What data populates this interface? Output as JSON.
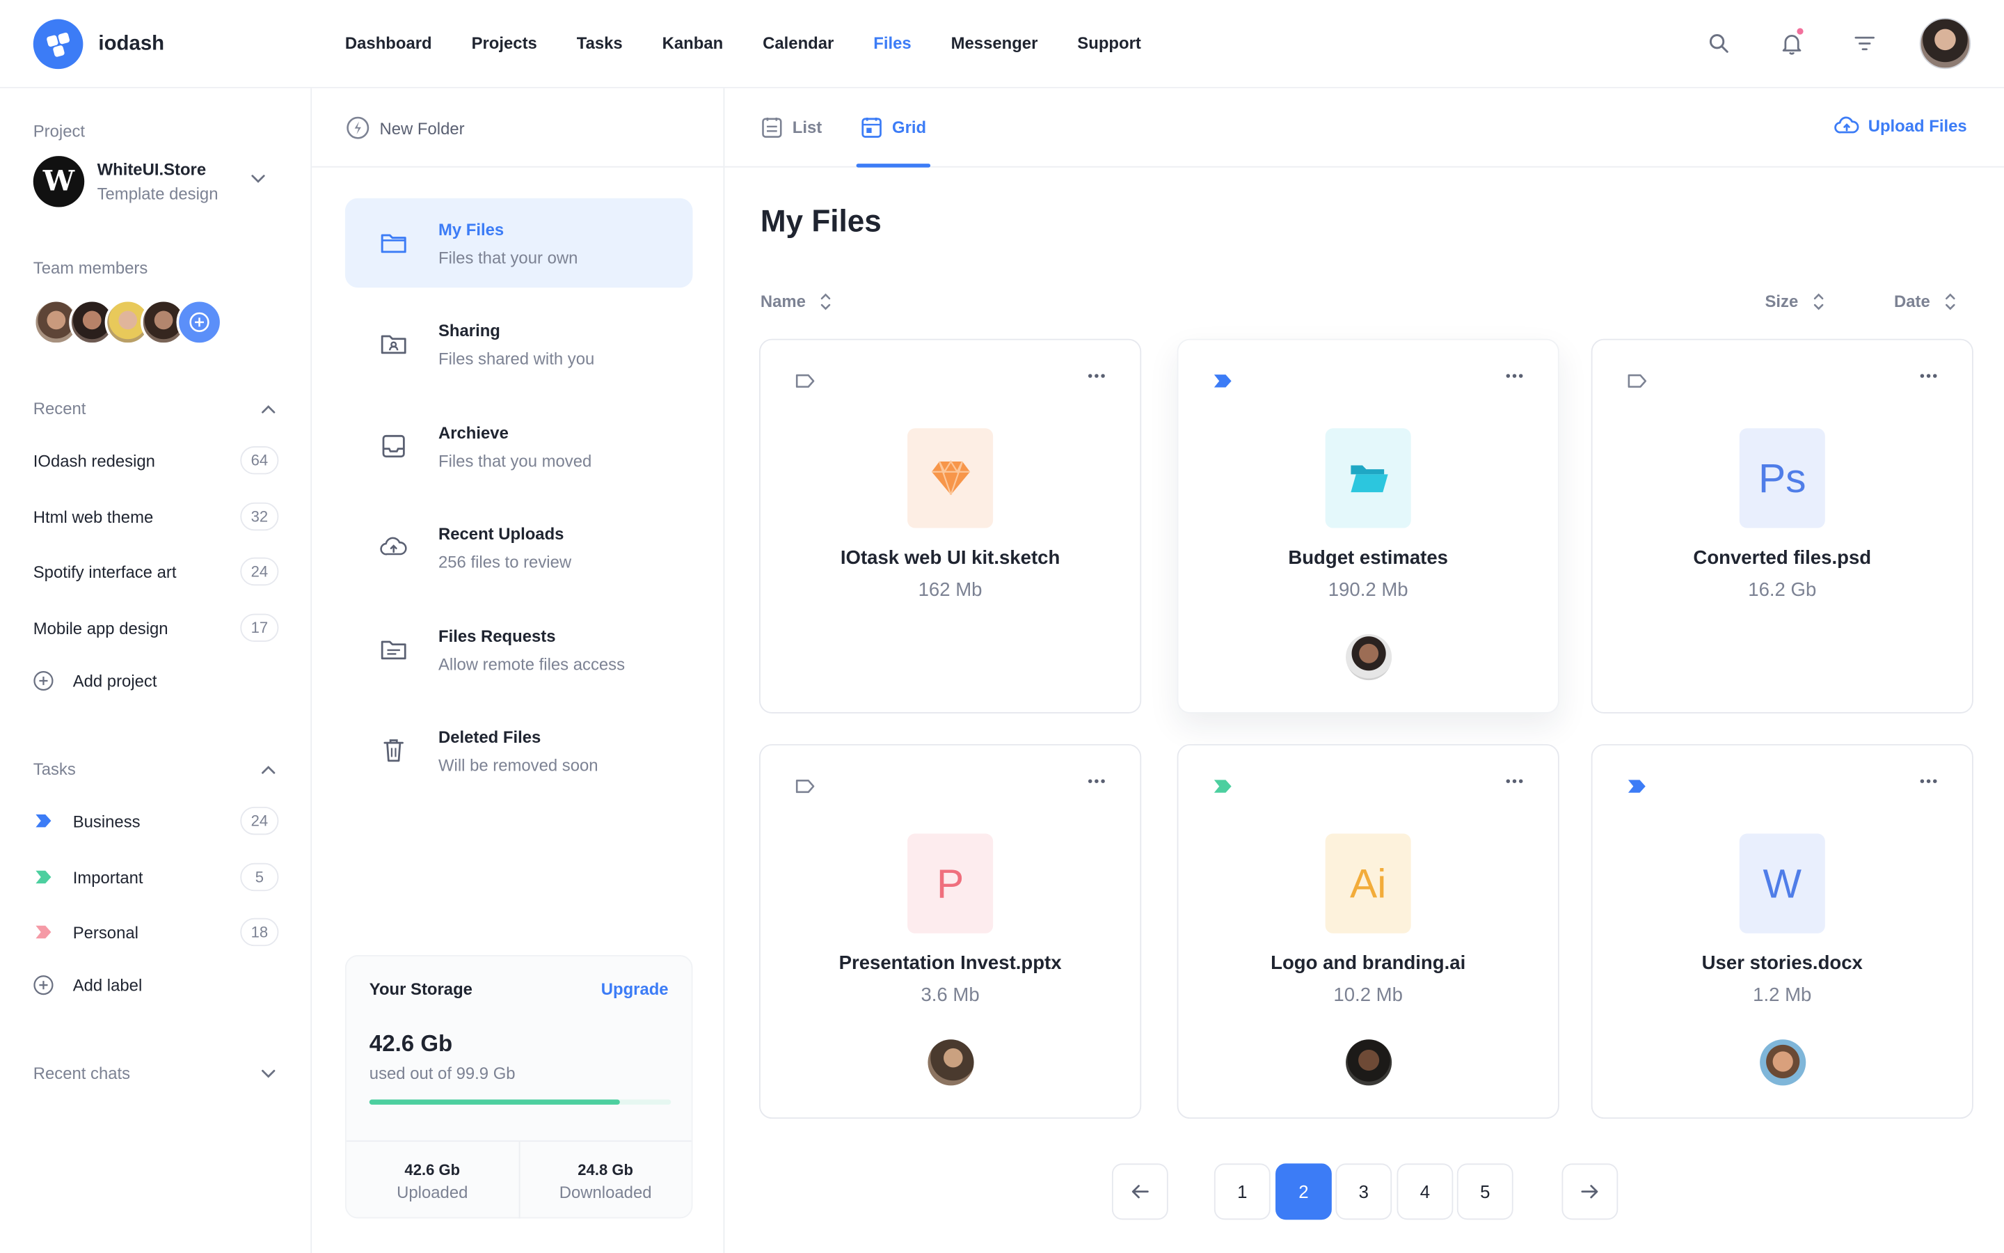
{
  "app": {
    "name": "iodash"
  },
  "nav": [
    "Dashboard",
    "Projects",
    "Tasks",
    "Kanban",
    "Calendar",
    "Files",
    "Messenger",
    "Support"
  ],
  "nav_active": "Files",
  "sidebar": {
    "project_label": "Project",
    "project_name": "WhiteUI.Store",
    "project_sub": "Template design",
    "project_logo_letter": "W",
    "team_label": "Team members",
    "recent_label": "Recent",
    "recent": [
      {
        "label": "IOdash redesign",
        "count": "64"
      },
      {
        "label": "Html web theme",
        "count": "32"
      },
      {
        "label": "Spotify interface art",
        "count": "24"
      },
      {
        "label": "Mobile app design",
        "count": "17"
      }
    ],
    "add_project": "Add project",
    "tasks_label": "Tasks",
    "tasks": [
      {
        "label": "Business",
        "count": "24",
        "color": "#3c7cf6"
      },
      {
        "label": "Important",
        "count": "5",
        "color": "#4ccf9f"
      },
      {
        "label": "Personal",
        "count": "18",
        "color": "#f59aa6"
      }
    ],
    "add_label": "Add label",
    "recent_chats": "Recent chats"
  },
  "folders": {
    "new_folder": "New Folder",
    "items": [
      {
        "title": "My Files",
        "sub": "Files that your own"
      },
      {
        "title": "Sharing",
        "sub": "Files shared with you"
      },
      {
        "title": "Archieve",
        "sub": "Files that you moved"
      },
      {
        "title": "Recent Uploads",
        "sub": "256 files to review"
      },
      {
        "title": "Files Requests",
        "sub": "Allow remote files access"
      },
      {
        "title": "Deleted Files",
        "sub": "Will be removed soon"
      }
    ]
  },
  "storage": {
    "title": "Your Storage",
    "upgrade": "Upgrade",
    "used": "42.6 Gb",
    "used_sub": "used out of 99.9 Gb",
    "used_fraction": 0.83,
    "uploaded_value": "42.6 Gb",
    "uploaded_label": "Uploaded",
    "downloaded_value": "24.8 Gb",
    "downloaded_label": "Downloaded"
  },
  "main": {
    "tab_list": "List",
    "tab_grid": "Grid",
    "upload": "Upload Files",
    "title": "My Files",
    "col_name": "Name",
    "col_size": "Size",
    "col_date": "Date"
  },
  "files": [
    {
      "name": "IOtask web UI kit.sketch",
      "size": "162 Mb",
      "icon": "sketch-diamond",
      "glyph": "",
      "bg": "#fdeee4",
      "fg": "#f7964a",
      "tag": "outline"
    },
    {
      "name": "Budget estimates",
      "size": "190.2 Mb",
      "icon": "folder-open",
      "glyph": "",
      "bg": "#e4f8fb",
      "fg": "#2cc6de",
      "tag": "blue"
    },
    {
      "name": "Converted files.psd",
      "size": "16.2 Gb",
      "icon": "photoshop",
      "glyph": "Ps",
      "bg": "#e9effd",
      "fg": "#4f7de8",
      "tag": "outline"
    },
    {
      "name": "Presentation Invest.pptx",
      "size": "3.6 Mb",
      "icon": "powerpoint",
      "glyph": "P",
      "bg": "#fdecee",
      "fg": "#ef6f7d",
      "tag": "outline"
    },
    {
      "name": "Logo and branding.ai",
      "size": "10.2 Mb",
      "icon": "illustrator",
      "glyph": "Ai",
      "bg": "#fdf2dc",
      "fg": "#f2ac3a",
      "tag": "green"
    },
    {
      "name": "User stories.docx",
      "size": "1.2 Mb",
      "icon": "word",
      "glyph": "W",
      "bg": "#e9effd",
      "fg": "#4f7de8",
      "tag": "blue"
    }
  ],
  "pagination": {
    "pages": [
      "1",
      "2",
      "3",
      "4",
      "5"
    ],
    "active": "2"
  }
}
